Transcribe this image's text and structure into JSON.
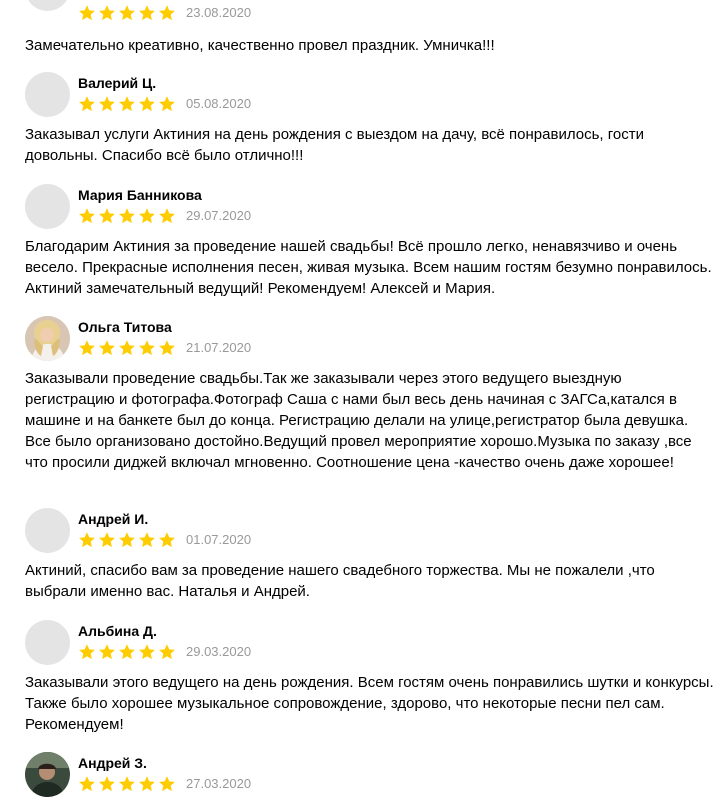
{
  "colors": {
    "star": "#FFCC00",
    "date": "#999999",
    "avatar_placeholder": "#E4E4E4"
  },
  "reviews": [
    {
      "author": "",
      "rating": 5,
      "date": "23.08.2020",
      "avatar": "placeholder-avatar",
      "text": "Замечательно креативно, качественно провел праздник. Умничка!!!"
    },
    {
      "author": "Валерий Ц.",
      "rating": 5,
      "date": "05.08.2020",
      "avatar": "placeholder-avatar",
      "text": "Заказывал услуги Актиния на день рождения с выездом на дачу, всё понравилось, гости довольны. Спасибо всё было отлично!!!"
    },
    {
      "author": "Мария Банникова",
      "rating": 5,
      "date": "29.07.2020",
      "avatar": "placeholder-avatar",
      "text": "Благодарим Актиния за проведение нашей свадьбы! Всё прошло легко, ненавязчиво и очень весело. Прекрасные исполнения песен, живая музыка. Всем нашим гостям безумно понравилось. Актиний замечательный ведущий! Рекомендуем! Алексей и Мария."
    },
    {
      "author": "Ольга Титова",
      "rating": 5,
      "date": "21.07.2020",
      "avatar": "photo-avatar",
      "text": "Заказывали проведение свадьбы.Так же заказывали через этого ведущего выездную регистрацию и фотографа.Фотограф Саша с нами был весь день начиная с ЗАГСа,катался в машине и на банкете был до конца. Регистрацию делали на улице,регистратор была девушка. Все было организовано достойно.Ведущий провел мероприятие хорошо.Музыка по заказу ,все что просили диджей включал мгновенно. Соотношение цена -качество очень даже хорошее!"
    },
    {
      "author": "Андрей И.",
      "rating": 5,
      "date": "01.07.2020",
      "avatar": "placeholder-avatar",
      "text": "Актиний, спасибо вам за проведение нашего свадебного торжества. Мы не пожалели ,что выбрали именно вас. Наталья и Андрей."
    },
    {
      "author": "Альбина Д.",
      "rating": 5,
      "date": "29.03.2020",
      "avatar": "placeholder-avatar",
      "text": "Заказывали этого ведущего на день рождения. Всем гостям очень понравились шутки и конкурсы. Также было хорошее музыкальное сопровождение, здорово, что некоторые песни пел сам. Рекомендуем!"
    },
    {
      "author": "Андрей З.",
      "rating": 5,
      "date": "27.03.2020",
      "avatar": "photo-avatar",
      "text": ""
    }
  ]
}
